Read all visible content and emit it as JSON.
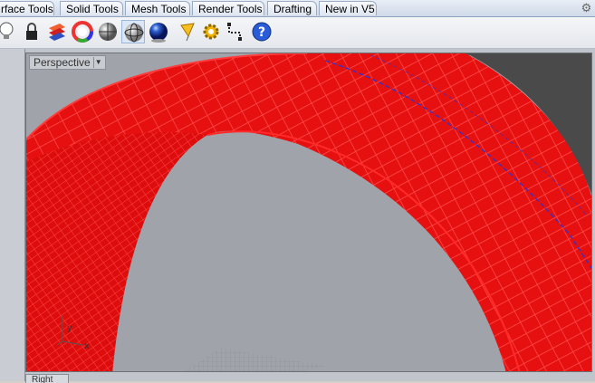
{
  "tabs": [
    {
      "label": "rface Tools"
    },
    {
      "label": "Solid Tools"
    },
    {
      "label": "Mesh Tools"
    },
    {
      "label": "Render Tools"
    },
    {
      "label": "Drafting"
    },
    {
      "label": "New in V5"
    }
  ],
  "toolbar": {
    "icons": [
      "light-icon",
      "lock-icon",
      "layer-icon",
      "color-wheel-icon",
      "shaded-sphere-icon",
      "wireframe-sphere-icon",
      "rendered-sphere-icon",
      "cone-light-icon",
      "gear-cog-icon",
      "dimension-icon",
      "help-icon"
    ]
  },
  "viewport": {
    "label": "Perspective",
    "axis_y": "y",
    "axis_x": "x",
    "bottom_tab": "Right"
  },
  "colors": {
    "mesh_red": "#ee1111",
    "mesh_line": "#ff3333",
    "edge_blue": "#3333cc",
    "viewport_bg": "#a0a4aa"
  }
}
